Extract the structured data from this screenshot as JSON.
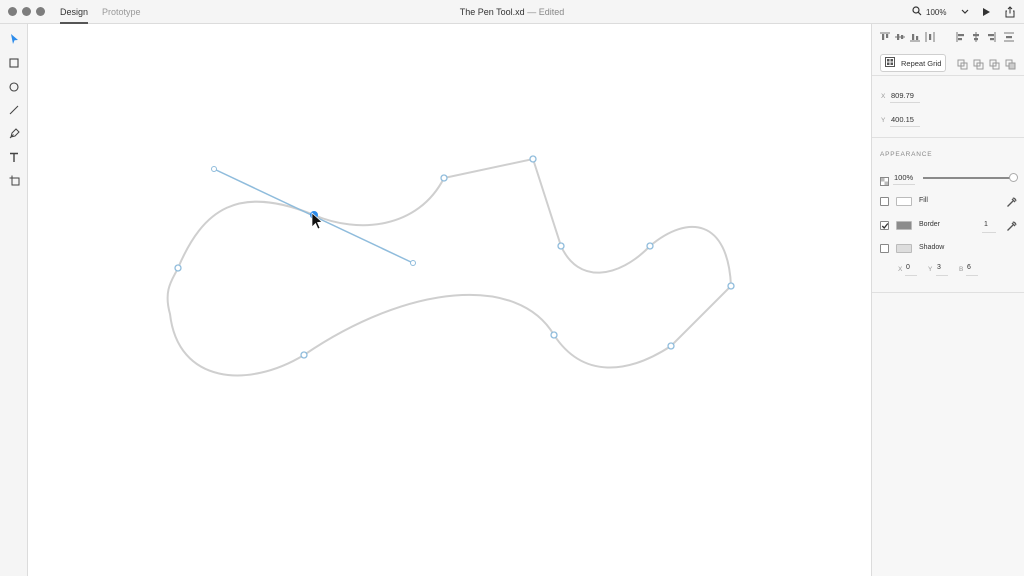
{
  "window": {
    "title": "The Pen Tool.xd",
    "title_suffix": "— Edited"
  },
  "tabs": {
    "design": "Design",
    "prototype": "Prototype"
  },
  "zoom": {
    "level": "100%"
  },
  "toolbar": {
    "tools": [
      "select-tool",
      "rectangle-tool",
      "ellipse-tool",
      "line-tool",
      "pen-tool",
      "text-tool",
      "artboard-tool"
    ],
    "active": "select-tool"
  },
  "inspector": {
    "repeat_grid_label": "Repeat Grid",
    "x_label": "X",
    "x_value": "809.79",
    "y_label": "Y",
    "y_value": "400.15",
    "appearance_heading": "APPEARANCE",
    "opacity": "100%",
    "opacity_fraction": 1.0,
    "fill": {
      "label": "Fill",
      "checked": false,
      "color": "#ffffff"
    },
    "border": {
      "label": "Border",
      "checked": true,
      "color": "#8c8c8c",
      "width": "1"
    },
    "shadow": {
      "label": "Shadow",
      "checked": false,
      "x_label": "X",
      "x": "0",
      "y_label": "Y",
      "y": "3",
      "b_label": "B",
      "b": "6"
    }
  },
  "colors": {
    "accent": "#2d8ceb",
    "handle": "#8fbcdc",
    "path": "#cfcfcf"
  }
}
